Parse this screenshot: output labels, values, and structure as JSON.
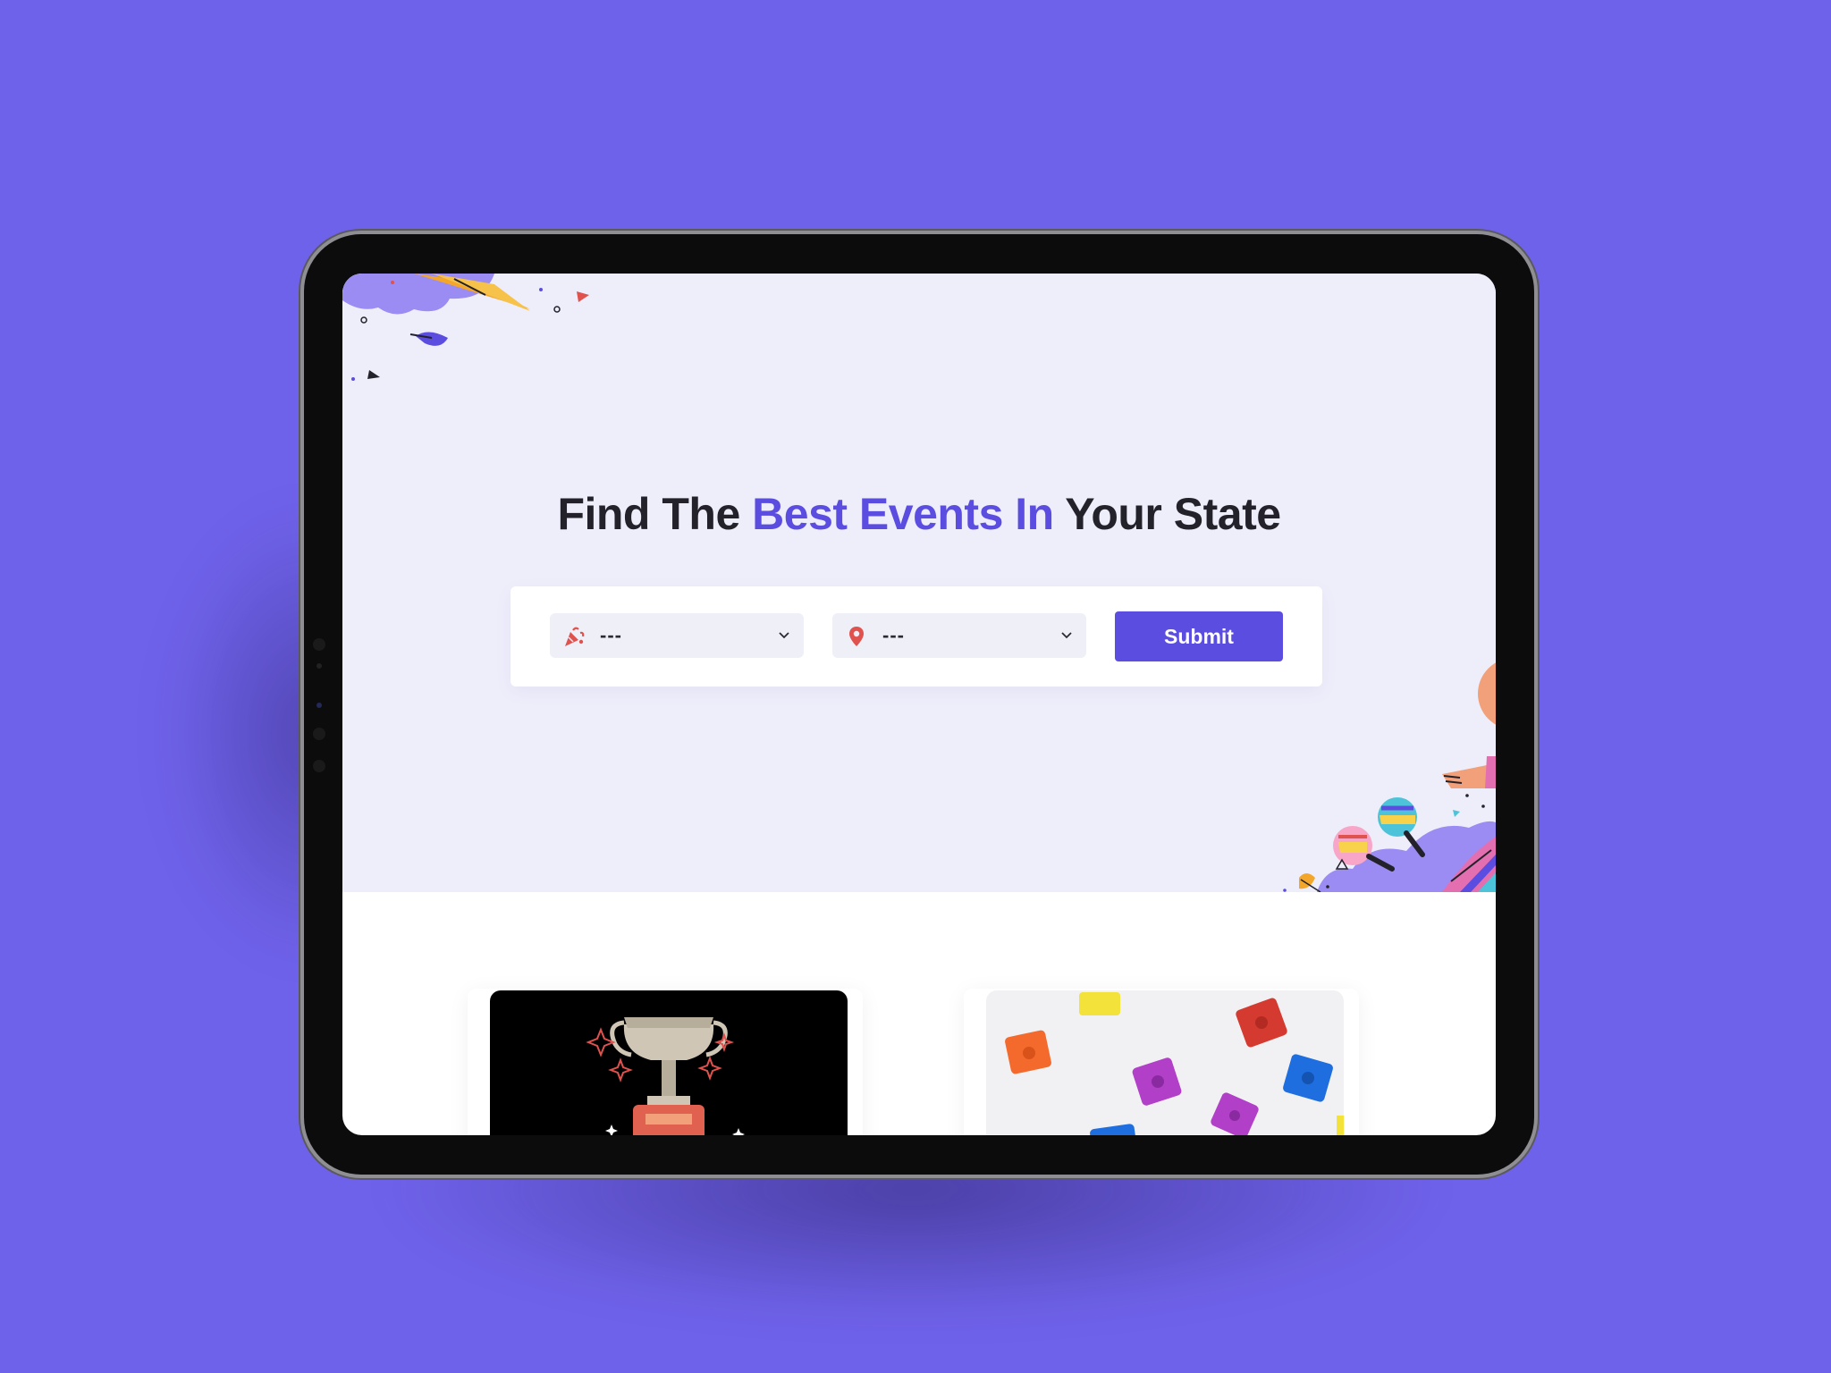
{
  "hero": {
    "headline_part1": "Find The ",
    "headline_accent": "Best Events In",
    "headline_part2": " Your State"
  },
  "search": {
    "category_select": {
      "icon": "party-popper-icon",
      "value": "---"
    },
    "location_select": {
      "icon": "location-pin-icon",
      "value": "---"
    },
    "submit_label": "Submit"
  },
  "events": [
    {
      "image": "trophy-image"
    },
    {
      "image": "toy-blocks-image"
    }
  ],
  "colors": {
    "background": "#6f62ea",
    "accent": "#5b4de0",
    "hero_bg": "#eeeefb",
    "icon_red": "#e0524e"
  }
}
